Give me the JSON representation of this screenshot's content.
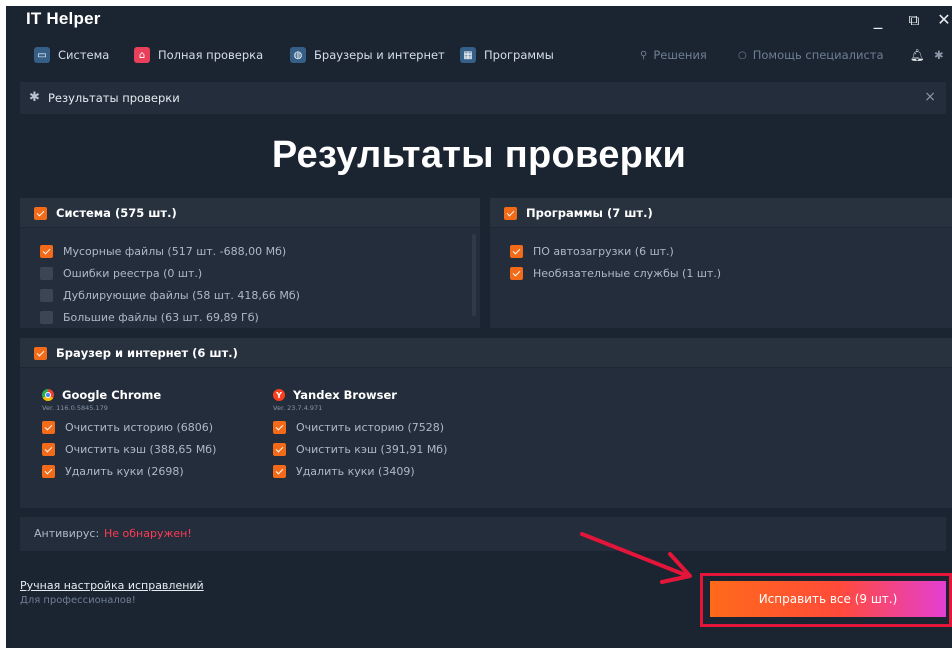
{
  "window": {
    "title": "IT Helper",
    "minimize": "_",
    "maximize": "⧉",
    "close": "✕"
  },
  "nav": {
    "items": [
      {
        "label": "Система",
        "icon": "monitor-icon",
        "color": "#3d6e9b"
      },
      {
        "label": "Полная проверка",
        "icon": "home-icon",
        "color": "#e8405a"
      },
      {
        "label": "Браузеры и интернет",
        "icon": "globe-icon",
        "color": "#3d6e9b"
      },
      {
        "label": "Программы",
        "icon": "apps-icon",
        "color": "#3d6e9b"
      }
    ],
    "right": [
      {
        "label": "Решения",
        "icon": "search-icon"
      },
      {
        "label": "Помощь специалиста",
        "icon": "chat-icon"
      }
    ],
    "bell_icon": "bell-icon",
    "settings_icon": "gear-icon"
  },
  "panel": {
    "title": "Результаты проверки",
    "close": "×"
  },
  "heading": "Результаты проверки",
  "system_card": {
    "title": "Система (575 шт.)",
    "checked": true,
    "items": [
      {
        "label": "Мусорные файлы (517 шт. -688,00 Мб)",
        "checked": true
      },
      {
        "label": "Ошибки реестра (0 шт.)",
        "checked": false
      },
      {
        "label": "Дублирующие файлы (58 шт. 418,66 Мб)",
        "checked": false
      },
      {
        "label": "Большие файлы (63 шт. 69,89 Гб)",
        "checked": false
      }
    ]
  },
  "programs_card": {
    "title": "Программы (7 шт.)",
    "checked": true,
    "items": [
      {
        "label": "ПО автозагрузки (6 шт.)",
        "checked": true
      },
      {
        "label": "Необязательные службы (1 шт.)",
        "checked": true
      }
    ]
  },
  "browser_card": {
    "title": "Браузер и интернет (6 шт.)",
    "checked": true,
    "browsers": [
      {
        "name": "Google Chrome",
        "version": "Ver. 116.0.5845.179",
        "icon": "chrome-icon",
        "items": [
          {
            "label": "Очистить историю (6806)",
            "checked": true
          },
          {
            "label": "Очистить кэш (388,65 Мб)",
            "checked": true
          },
          {
            "label": "Удалить куки (2698)",
            "checked": true
          }
        ]
      },
      {
        "name": "Yandex Browser",
        "version": "Ver. 23.7.4.971",
        "icon": "yandex-icon",
        "items": [
          {
            "label": "Очистить историю (7528)",
            "checked": true
          },
          {
            "label": "Очистить кэш (391,91 Мб)",
            "checked": true
          },
          {
            "label": "Удалить куки (3409)",
            "checked": true
          }
        ]
      }
    ]
  },
  "antivirus": {
    "label": "Антивирус:",
    "status": "Не обнаружен!",
    "status_color": "#ff3b54"
  },
  "manual": {
    "link": "Ручная настройка исправлений",
    "subtitle": "Для профессионалов!"
  },
  "fix_button": {
    "label": "Исправить все (9 шт.)"
  },
  "colors": {
    "background": "#1b2431",
    "card": "#232d3b",
    "accent": "#f36a18",
    "highlight": "#e3163a"
  }
}
